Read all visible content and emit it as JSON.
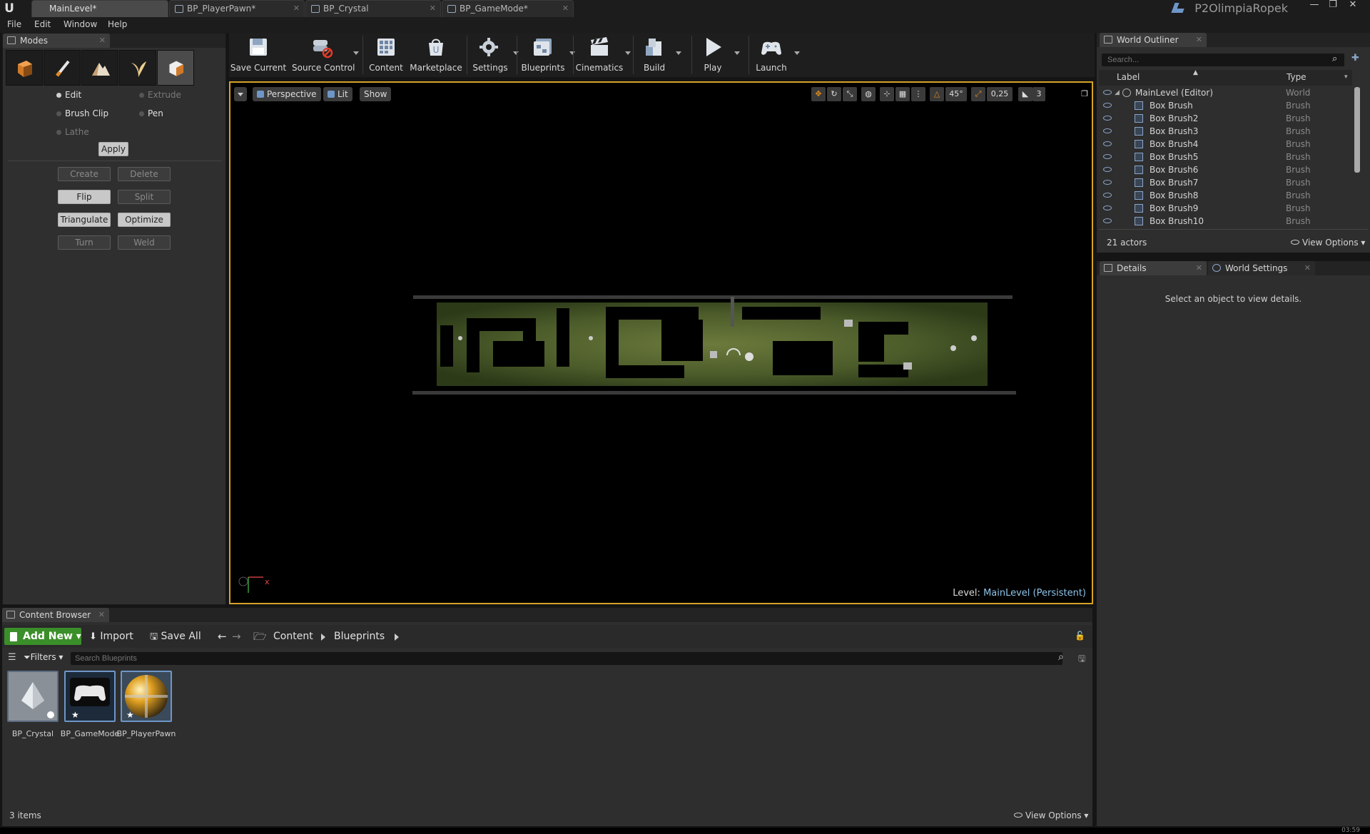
{
  "title_bar": {
    "tabs": [
      {
        "label": "MainLevel*"
      },
      {
        "label": "BP_PlayerPawn*"
      },
      {
        "label": "BP_Crystal"
      },
      {
        "label": "BP_GameMode*"
      }
    ],
    "project": "P2OlimpiaRopek"
  },
  "menu": {
    "items": [
      "File",
      "Edit",
      "Window",
      "Help"
    ]
  },
  "modes": {
    "tab_label": "Modes",
    "icons": [
      "place-mode-icon",
      "paint-mode-icon",
      "landscape-mode-icon",
      "foliage-mode-icon",
      "geometry-mode-icon"
    ],
    "radio": {
      "edit": "Edit",
      "extrude": "Extrude",
      "brush_clip": "Brush Clip",
      "pen": "Pen",
      "lathe": "Lathe"
    },
    "apply": "Apply",
    "buttons": {
      "create": "Create",
      "delete": "Delete",
      "flip": "Flip",
      "split": "Split",
      "triangulate": "Triangulate",
      "optimize": "Optimize",
      "turn": "Turn",
      "weld": "Weld"
    }
  },
  "toolbar": {
    "save_current": "Save Current",
    "source_control": "Source Control",
    "content": "Content",
    "marketplace": "Marketplace",
    "settings": "Settings",
    "blueprints": "Blueprints",
    "cinematics": "Cinematics",
    "build": "Build",
    "play": "Play",
    "launch": "Launch"
  },
  "viewport": {
    "perspective": "Perspective",
    "lit": "Lit",
    "show": "Show",
    "angle_snap": "45°",
    "scale_snap": "0,25",
    "camera_speed": "3",
    "level_prefix": "Level:",
    "level_name": "MainLevel (Persistent)",
    "axis_x": "x"
  },
  "outliner": {
    "tab_label": "World Outliner",
    "search_placeholder": "Search...",
    "col_label": "Label",
    "col_type": "Type",
    "root": {
      "label": "MainLevel (Editor)",
      "type": "World"
    },
    "rows": [
      {
        "label": "Box Brush",
        "type": "Brush"
      },
      {
        "label": "Box Brush2",
        "type": "Brush"
      },
      {
        "label": "Box Brush3",
        "type": "Brush"
      },
      {
        "label": "Box Brush4",
        "type": "Brush"
      },
      {
        "label": "Box Brush5",
        "type": "Brush"
      },
      {
        "label": "Box Brush6",
        "type": "Brush"
      },
      {
        "label": "Box Brush7",
        "type": "Brush"
      },
      {
        "label": "Box Brush8",
        "type": "Brush"
      },
      {
        "label": "Box Brush9",
        "type": "Brush"
      },
      {
        "label": "Box Brush10",
        "type": "Brush"
      }
    ],
    "actors_count": "21 actors",
    "view_options": "View Options"
  },
  "details": {
    "tab_label": "Details",
    "world_settings_tab": "World Settings",
    "empty_message": "Select an object to view details."
  },
  "content_browser": {
    "tab_label": "Content Browser",
    "add_new": "Add New",
    "import": "Import",
    "save_all": "Save All",
    "breadcrumb": [
      "Content",
      "Blueprints"
    ],
    "filters": "Filters",
    "search_placeholder": "Search Blueprints",
    "assets": [
      {
        "name": "BP_Crystal"
      },
      {
        "name": "BP_GameMode"
      },
      {
        "name": "BP_PlayerPawn"
      }
    ],
    "items_count": "3 items",
    "view_options": "View Options"
  },
  "colors": {
    "viewport_border": "#d6a227",
    "add_new_green": "#3b8f2a",
    "level_name_blue": "#8cc3e8"
  },
  "clock": "03:59"
}
